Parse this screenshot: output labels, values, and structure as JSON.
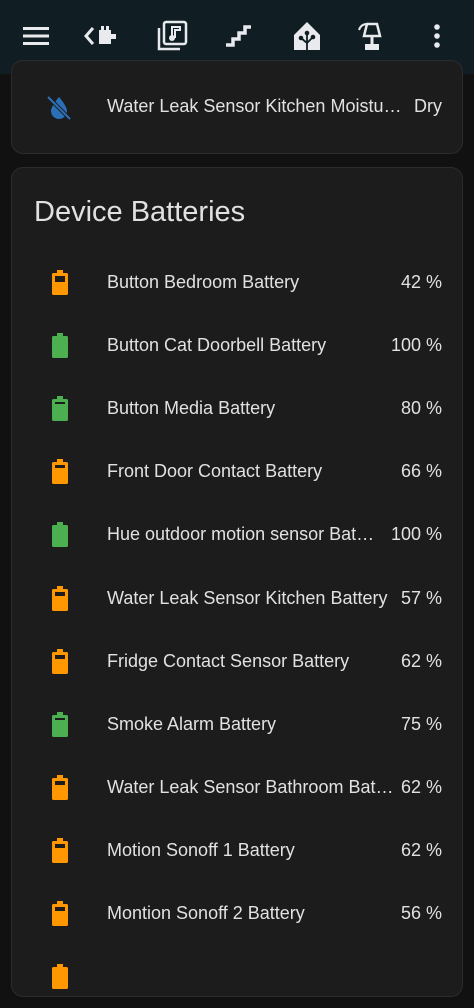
{
  "colors": {
    "topbar_bg": "#101e24",
    "card_bg": "#1c1c1c",
    "battery_green": "#4caf50",
    "battery_orange": "#ff9800",
    "leak_icon": "#2b6fb6"
  },
  "topbar": {
    "icons": [
      "menu-icon",
      "back-to-code-icon",
      "music-library-icon",
      "stairs-icon",
      "home-assistant-icon",
      "robot-vacuum-icon",
      "more-vertical-icon"
    ],
    "active_index": 4
  },
  "leak_card": {
    "label": "Water Leak Sensor Kitchen Moistu…",
    "value": "Dry",
    "icon": "water-off-icon"
  },
  "batteries": {
    "title": "Device Batteries",
    "items": [
      {
        "label": "Button Bedroom Battery",
        "value": "42 %",
        "level": 42,
        "color": "orange"
      },
      {
        "label": "Button Cat Doorbell Battery",
        "value": "100 %",
        "level": 100,
        "color": "green"
      },
      {
        "label": "Button Media Battery",
        "value": "80 %",
        "level": 80,
        "color": "green"
      },
      {
        "label": "Front Door Contact Battery",
        "value": "66 %",
        "level": 66,
        "color": "orange"
      },
      {
        "label": "Hue outdoor motion sensor Bat…",
        "value": "100 %",
        "level": 100,
        "color": "green"
      },
      {
        "label": "Water Leak Sensor Kitchen Battery",
        "value": "57 %",
        "level": 57,
        "color": "orange"
      },
      {
        "label": "Fridge Contact Sensor Battery",
        "value": "62 %",
        "level": 62,
        "color": "orange"
      },
      {
        "label": "Smoke Alarm Battery",
        "value": "75 %",
        "level": 75,
        "color": "green"
      },
      {
        "label": "Water Leak Sensor Bathroom Bat…",
        "value": "62 %",
        "level": 62,
        "color": "orange"
      },
      {
        "label": "Motion Sonoff 1 Battery",
        "value": "62 %",
        "level": 62,
        "color": "orange"
      },
      {
        "label": "Montion Sonoff 2 Battery",
        "value": "56 %",
        "level": 56,
        "color": "orange"
      }
    ]
  }
}
